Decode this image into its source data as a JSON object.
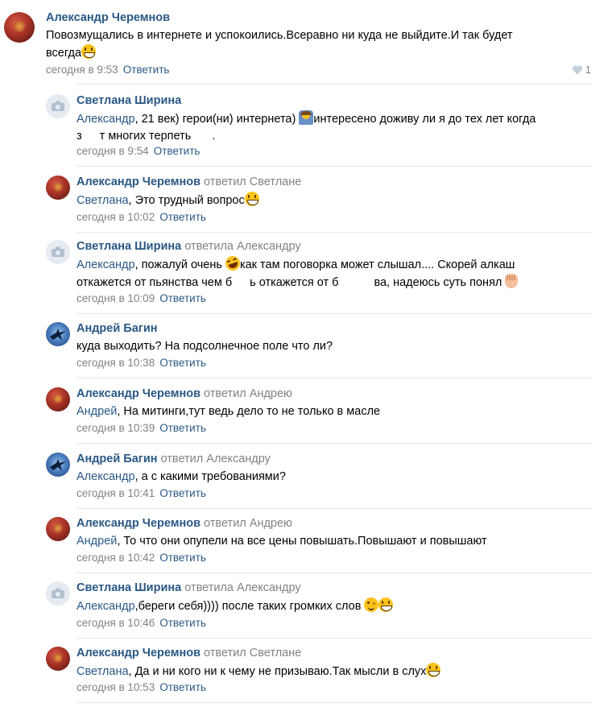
{
  "root": {
    "author": "Александр Черемнов",
    "line1": "Повозмущались в интернете и успокоились.Всеравно ни куда не выйдите.И так будет",
    "line2": "всегда",
    "time": "сегодня в 9:53",
    "reply": "Ответить",
    "likes": "1"
  },
  "replies": [
    {
      "author": "Светлана Ширина",
      "replied": "",
      "mention": "Александр",
      "l1a": ", 21 век) герои(ни) интернета)",
      "l1b": "интересено доживу ли я до тех лет когда",
      "l2a": "з",
      "l2b": "т многих терпеть",
      "l2c": ".",
      "time": "сегодня в 9:54",
      "reply": "Ответить"
    },
    {
      "author": "Александр Черемнов",
      "replied": "ответил Светлане",
      "mention": "Светлана",
      "text": ", Это трудный вопрос",
      "time": "сегодня в 10:02",
      "reply": "Ответить"
    },
    {
      "author": "Светлана Ширина",
      "replied": "ответила Александру",
      "mention": "Александр",
      "l1a": ", пожалуй очень",
      "l1b": "как там поговорка может слышал.... Скорей алкаш",
      "l2a": "откажется от пьянства чем б",
      "l2b": "ь откажется от б",
      "l2c": "ва, надеюсь суть понял",
      "time": "сегодня в 10:09",
      "reply": "Ответить"
    },
    {
      "author": "Андрей Багин",
      "replied": "",
      "text": "куда выходить? На подсолнечное поле что ли?",
      "time": "сегодня в 10:38",
      "reply": "Ответить"
    },
    {
      "author": "Александр Черемнов",
      "replied": "ответил Андрею",
      "mention": "Андрей",
      "text": ", На митинги,тут ведь дело то не только в масле",
      "time": "сегодня в 10:39",
      "reply": "Ответить"
    },
    {
      "author": "Андрей Багин",
      "replied": "ответил Александру",
      "mention": "Александр",
      "text": ", а с какими требованиями?",
      "time": "сегодня в 10:41",
      "reply": "Ответить"
    },
    {
      "author": "Александр Черемнов",
      "replied": "ответил Андрею",
      "mention": "Андрей",
      "text": ", То что они опупели на все цены повышать.Повышают и повышают",
      "time": "сегодня в 10:42",
      "reply": "Ответить"
    },
    {
      "author": "Светлана Ширина",
      "replied": "ответила Александру",
      "mention": "Александр",
      "text": ",береги себя)))) после таких громких слов",
      "time": "сегодня в 10:46",
      "reply": "Ответить"
    },
    {
      "author": "Александр Черемнов",
      "replied": "ответил Светлане",
      "mention": "Светлана",
      "text": ", Да и ни кого ни к чему не призываю.Так мысли в слух",
      "time": "сегодня в 10:53",
      "reply": "Ответить"
    }
  ]
}
